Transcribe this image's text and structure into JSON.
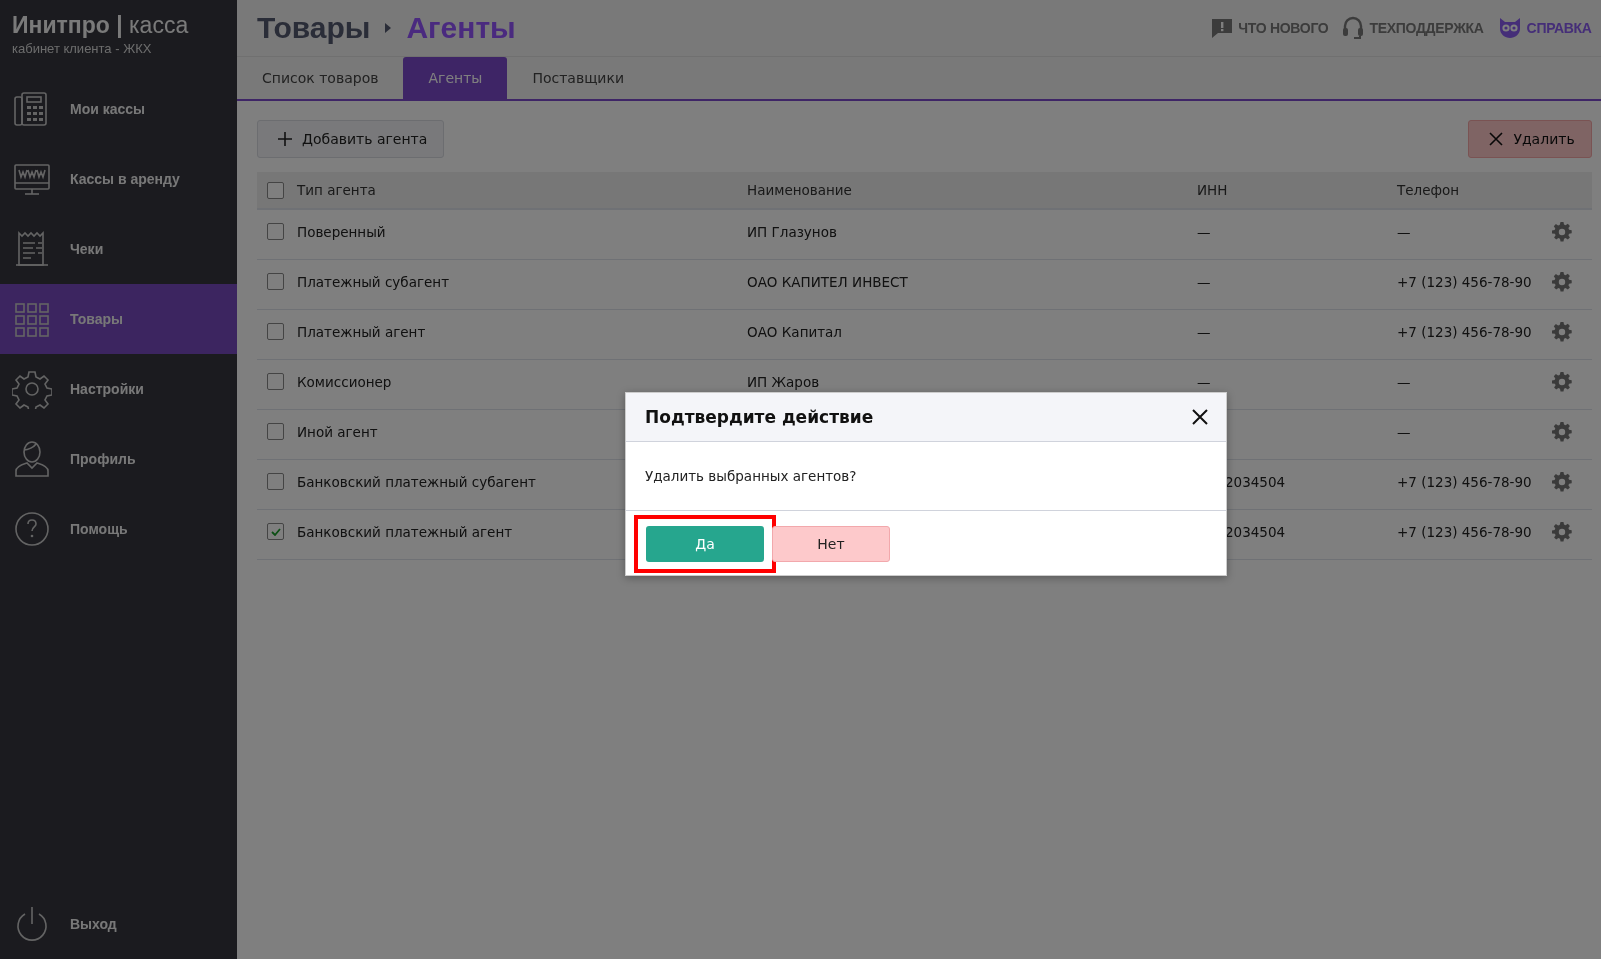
{
  "sidebar": {
    "brand": "**Инитпро |** касса",
    "subtitle": "кабинет клиента - ЖКХ",
    "items": [
      {
        "kind": "register",
        "label": "Мои кассы",
        "selected": false
      },
      {
        "kind": "monitor",
        "label": "Кассы в аренду",
        "selected": false
      },
      {
        "kind": "receipt",
        "label": "Чеки",
        "selected": false
      },
      {
        "kind": "grid",
        "label": "Товары",
        "selected": true
      },
      {
        "kind": "gear",
        "label": "Настройки",
        "selected": false
      },
      {
        "kind": "person",
        "label": "Профиль",
        "selected": false
      },
      {
        "kind": "help",
        "label": "Помощь",
        "selected": false
      }
    ],
    "logout": {
      "kind": "power",
      "label": "Выход"
    }
  },
  "header": {
    "breadcrumb": [
      "Товары",
      "Агенты"
    ],
    "links": [
      {
        "kind": "alert",
        "label": "ЧТО НОВОГО"
      },
      {
        "kind": "headset",
        "label": "ТЕХПОДДЕРЖКА"
      },
      {
        "kind": "owl",
        "label": "СПРАВКА"
      }
    ]
  },
  "tabs": [
    {
      "label": "Список товаров",
      "selected": false
    },
    {
      "label": "Агенты",
      "selected": true
    },
    {
      "label": "Поставщики",
      "selected": false
    }
  ],
  "toolbar": {
    "add_button": "Добавить агента",
    "delete_button": "Удалить"
  },
  "table": {
    "header_checked": false,
    "columns": [
      "Тип агента",
      "Наименование",
      "ИНН",
      "Телефон"
    ],
    "rows": [
      {
        "checked": false,
        "type": "Поверенный",
        "name": "ИП Глазунов",
        "inn": "—",
        "phone": "—"
      },
      {
        "checked": false,
        "type": "Платежный субагент",
        "name": "ОАО КАПИТЕЛ ИНВЕСТ",
        "inn": "—",
        "phone": "+7 (123) 456-78-90"
      },
      {
        "checked": false,
        "type": "Платежный агент",
        "name": "ОАО Капитал",
        "inn": "—",
        "phone": "+7 (123) 456-78-90"
      },
      {
        "checked": false,
        "type": "Комиссионер",
        "name": "ИП Жаров",
        "inn": "—",
        "phone": "—"
      },
      {
        "checked": false,
        "type": "Иной агент",
        "phone": "—"
      },
      {
        "checked": false,
        "type": "Банковский платежный субагент",
        "inn": "2034504",
        "inn_partial": true,
        "phone": "+7 (123) 456-78-90"
      },
      {
        "checked": true,
        "type": "Банковский платежный агент",
        "inn": "2034504",
        "inn_partial": true,
        "phone": "+7 (123) 456-78-90"
      }
    ]
  },
  "dialog": {
    "title": "Подтвердите действие",
    "message": "Удалить выбранных агентов?",
    "buttons": [
      {
        "kind": "confirm",
        "label": "Да",
        "highlighted": true
      },
      {
        "kind": "cancel",
        "label": "Нет",
        "highlighted": false
      }
    ]
  }
}
